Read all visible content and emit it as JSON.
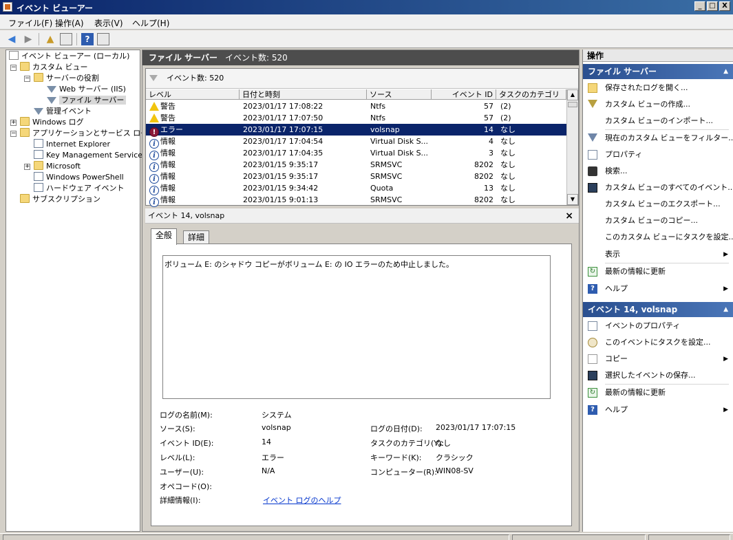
{
  "window": {
    "title": "イベント ビューアー",
    "buttons": [
      "_",
      "□",
      "X"
    ]
  },
  "menu": [
    "ファイル(F)",
    "操作(A)",
    "表示(V)",
    "ヘルプ(H)"
  ],
  "tree": [
    {
      "label": "イベント ビューアー (ローカル)"
    },
    {
      "label": "カスタム ビュー"
    },
    {
      "label": "サーバーの役割"
    },
    {
      "label": "Web サーバー (IIS)"
    },
    {
      "label": "ファイル サーバー"
    },
    {
      "label": "管理イベント"
    },
    {
      "label": "Windows ログ"
    },
    {
      "label": "アプリケーションとサービス ログ"
    },
    {
      "label": "Internet Explorer"
    },
    {
      "label": "Key Management Service"
    },
    {
      "label": "Microsoft"
    },
    {
      "label": "Windows PowerShell"
    },
    {
      "label": "ハードウェア イベント"
    },
    {
      "label": "サブスクリプション"
    }
  ],
  "center": {
    "title": "ファイル サーバー",
    "count": "イベント数: 520",
    "filter_text": "イベント数: 520",
    "columns": [
      "レベル",
      "日付と時刻",
      "ソース",
      "イベント ID",
      "タスクのカテゴリ"
    ],
    "rows": [
      {
        "level": "警告",
        "date": "2023/01/17 17:08:22",
        "source": "Ntfs",
        "id": "57",
        "task": "(2)"
      },
      {
        "level": "警告",
        "date": "2023/01/17 17:07:50",
        "source": "Ntfs",
        "id": "57",
        "task": "(2)"
      },
      {
        "level": "エラー",
        "date": "2023/01/17 17:07:15",
        "source": "volsnap",
        "id": "14",
        "task": "なし"
      },
      {
        "level": "情報",
        "date": "2023/01/17 17:04:54",
        "source": "Virtual Disk S...",
        "id": "4",
        "task": "なし"
      },
      {
        "level": "情報",
        "date": "2023/01/17 17:04:35",
        "source": "Virtual Disk S...",
        "id": "3",
        "task": "なし"
      },
      {
        "level": "情報",
        "date": "2023/01/15 9:35:17",
        "source": "SRMSVC",
        "id": "8202",
        "task": "なし"
      },
      {
        "level": "情報",
        "date": "2023/01/15 9:35:17",
        "source": "SRMSVC",
        "id": "8202",
        "task": "なし"
      },
      {
        "level": "情報",
        "date": "2023/01/15 9:34:42",
        "source": "Quota",
        "id": "13",
        "task": "なし"
      },
      {
        "level": "情報",
        "date": "2023/01/15 9:01:13",
        "source": "SRMSVC",
        "id": "8202",
        "task": "なし"
      }
    ]
  },
  "detail": {
    "header": "イベント 14, volsnap",
    "tabs": [
      "全般",
      "詳細"
    ],
    "message": "ボリューム E: のシャドウ コピーがボリューム E: の IO エラーのため中止しました。",
    "labels": {
      "log_name": "ログの名前(M):",
      "source": "ソース(S):",
      "event_id": "イベント ID(E):",
      "level": "レベル(L):",
      "user": "ユーザー(U):",
      "opcode": "オペコード(O):",
      "more_info": "詳細情報(I):",
      "logged": "ログの日付(D):",
      "task_cat": "タスクのカテゴリ(Y):",
      "keywords": "キーワード(K):",
      "computer": "コンピューター(R):"
    },
    "values": {
      "log_name": "システム",
      "source": "volsnap",
      "event_id": "14",
      "level": "エラー",
      "user": "N/A",
      "opcode": "",
      "more_info": "イベント ログのヘルプ",
      "logged": "2023/01/17 17:07:15",
      "task_cat": "なし",
      "keywords": "クラシック",
      "computer": "WIN08-SV"
    }
  },
  "actions": {
    "title": "操作",
    "section1": "ファイル サーバー",
    "items1": [
      "保存されたログを開く...",
      "カスタム ビューの作成...",
      "カスタム ビューのインポート...",
      "現在のカスタム ビューをフィルター...",
      "プロパティ",
      "検索...",
      "カスタム ビューのすべてのイベント...",
      "カスタム ビューのエクスポート...",
      "カスタム ビューのコピー...",
      "このカスタム ビューにタスクを設定...",
      "表示",
      "最新の情報に更新",
      "ヘルプ"
    ],
    "section2": "イベント 14, volsnap",
    "items2": [
      "イベントのプロパティ",
      "このイベントにタスクを設定...",
      "コピー",
      "選択したイベントの保存...",
      "最新の情報に更新",
      "ヘルプ"
    ]
  }
}
